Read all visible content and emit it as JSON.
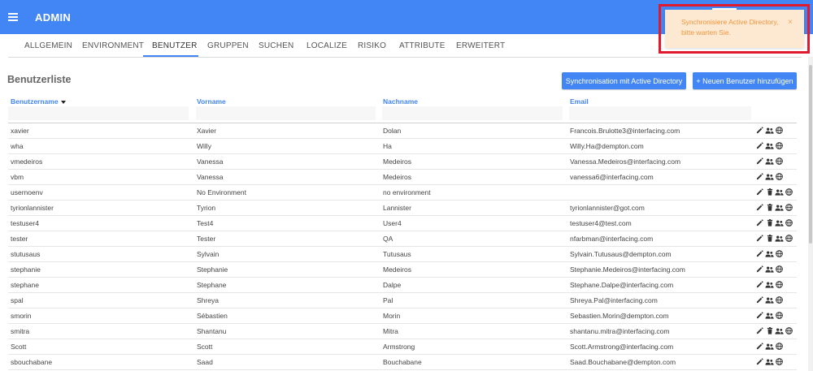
{
  "app": {
    "title": "ADMIN"
  },
  "tabs": [
    {
      "label": "ALLGEMEIN"
    },
    {
      "label": "ENVIRONMENT"
    },
    {
      "label": "BENUTZER"
    },
    {
      "label": "GRUPPEN"
    },
    {
      "label": "SUCHEN"
    },
    {
      "label": "LOCALIZE"
    },
    {
      "label": "RISIKO"
    },
    {
      "label": "ATTRIBUTE"
    },
    {
      "label": "ERWEITERT"
    }
  ],
  "active_tab": "BENUTZER",
  "page": {
    "title": "Benutzerliste",
    "sync_button": "Synchronisation mit Active Directory",
    "add_button": "+ Neuen Benutzer hinzufügen"
  },
  "columns": {
    "username": "Benutzername",
    "firstname": "Vorname",
    "lastname": "Nachname",
    "email": "Email"
  },
  "toast": {
    "message": "Synchronisiere Active Directory, bitte warten Sie.",
    "close": "×"
  },
  "actions_icons": [
    "edit-icon",
    "delete-icon",
    "groups-icon",
    "globe-icon"
  ],
  "colors": {
    "primary": "#4285f4",
    "toast_bg": "#fde8d2",
    "toast_text": "#f0963c",
    "highlight": "#e0192e"
  },
  "users": [
    {
      "username": "xavier",
      "firstname": "Xavier",
      "lastname": "Dolan",
      "email": "Francois.Brulotte3@interfacing.com",
      "deletable": false
    },
    {
      "username": "wha",
      "firstname": "Willy",
      "lastname": "Ha",
      "email": "Willy.Ha@dempton.com",
      "deletable": false
    },
    {
      "username": "vmedeiros",
      "firstname": "Vanessa",
      "lastname": "Medeiros",
      "email": "Vanessa.Medeiros@interfacing.com",
      "deletable": false
    },
    {
      "username": "vbm",
      "firstname": "Vanessa",
      "lastname": "Medeiros",
      "email": "vanessa6@interfacing.com",
      "deletable": false
    },
    {
      "username": "usernoenv",
      "firstname": "No Environment",
      "lastname": "no environment",
      "email": "",
      "deletable": true
    },
    {
      "username": "tyrionlannister",
      "firstname": "Tyrion",
      "lastname": "Lannister",
      "email": "tyrionlannister@got.com",
      "deletable": true
    },
    {
      "username": "testuser4",
      "firstname": "Test4",
      "lastname": "User4",
      "email": "testuser4@test.com",
      "deletable": true
    },
    {
      "username": "tester",
      "firstname": "Tester",
      "lastname": "QA",
      "email": "nfarbman@interfacing.com",
      "deletable": true
    },
    {
      "username": "stutusaus",
      "firstname": "Sylvain",
      "lastname": "Tutusaus",
      "email": "Sylvain.Tutusaus@dempton.com",
      "deletable": false
    },
    {
      "username": "stephanie",
      "firstname": "Stephanie",
      "lastname": "Medeiros",
      "email": "Stephanie.Medeiros@interfacing.com",
      "deletable": false
    },
    {
      "username": "stephane",
      "firstname": "Stephane",
      "lastname": "Dalpe",
      "email": "Stephane.Dalpe@interfacing.com",
      "deletable": false
    },
    {
      "username": "spal",
      "firstname": "Shreya",
      "lastname": "Pal",
      "email": "Shreya.Pal@interfacing.com",
      "deletable": false
    },
    {
      "username": "smorin",
      "firstname": "Sébastien",
      "lastname": "Morin",
      "email": "Sebastien.Morin@dempton.com",
      "deletable": false
    },
    {
      "username": "smitra",
      "firstname": "Shantanu",
      "lastname": "Mitra",
      "email": "shantanu.mitra@interfacing.com",
      "deletable": true
    },
    {
      "username": "Scott",
      "firstname": "Scott",
      "lastname": "Armstrong",
      "email": "Scott.Armstrong@interfacing.com",
      "deletable": false
    },
    {
      "username": "sbouchabane",
      "firstname": "Saad",
      "lastname": "Bouchabane",
      "email": "Saad.Bouchabane@dempton.com",
      "deletable": false
    }
  ]
}
